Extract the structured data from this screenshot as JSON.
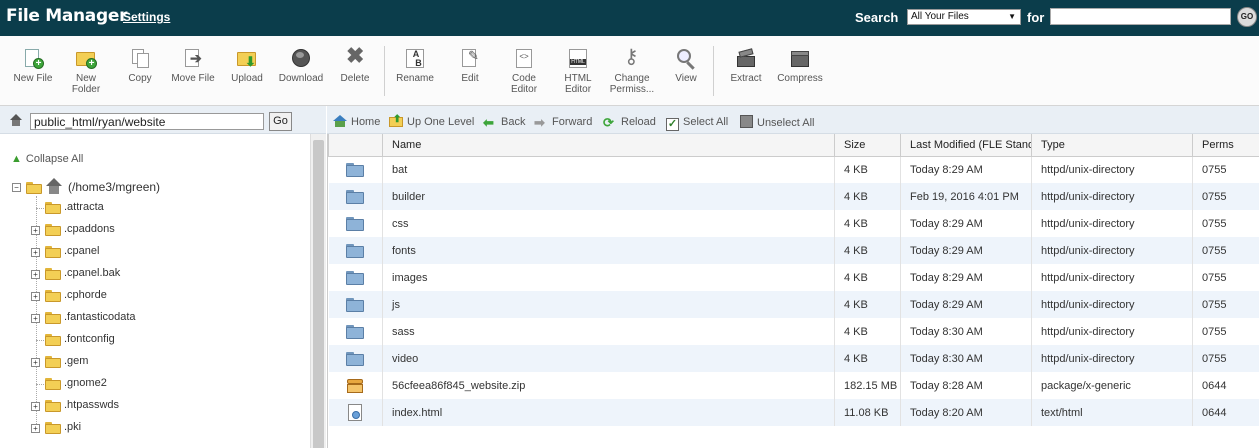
{
  "header": {
    "title": "File Manager",
    "settings_label": "Settings",
    "search_label": "Search",
    "search_scope": "All Your Files",
    "for_label": "for",
    "search_value": "",
    "go_label": "GO"
  },
  "toolbar": {
    "new_file": "New File",
    "new_folder_1": "New",
    "new_folder_2": "Folder",
    "copy": "Copy",
    "move_file": "Move File",
    "upload": "Upload",
    "download": "Download",
    "delete": "Delete",
    "rename": "Rename",
    "edit": "Edit",
    "code_editor_1": "Code",
    "code_editor_2": "Editor",
    "html_editor_1": "HTML",
    "html_editor_2": "Editor",
    "change_perms_1": "Change",
    "change_perms_2": "Permiss...",
    "view": "View",
    "extract": "Extract",
    "compress": "Compress"
  },
  "left": {
    "path_value": "public_html/ryan/website",
    "go_label": "Go",
    "collapse_all": "Collapse All",
    "root_label": "(/home3/mgreen)",
    "tree_items": [
      ".attracta",
      ".cpaddons",
      ".cpanel",
      ".cpanel.bak",
      ".cphorde",
      ".fantasticodata",
      ".fontconfig",
      ".gem",
      ".gnome2",
      ".htpasswds",
      ".pki"
    ]
  },
  "nav": {
    "home": "Home",
    "up_one_level": "Up One Level",
    "back": "Back",
    "forward": "Forward",
    "reload": "Reload",
    "select_all": "Select All",
    "unselect_all": "Unselect All"
  },
  "table": {
    "columns": [
      "Name",
      "Size",
      "Last Modified (FLE Standard Time)",
      "Type",
      "Perms"
    ],
    "rows": [
      {
        "icon": "folder",
        "name": "bat",
        "size": "4 KB",
        "modified": "Today 8:29 AM",
        "type": "httpd/unix-directory",
        "perms": "0755"
      },
      {
        "icon": "folder",
        "name": "builder",
        "size": "4 KB",
        "modified": "Feb 19, 2016 4:01 PM",
        "type": "httpd/unix-directory",
        "perms": "0755"
      },
      {
        "icon": "folder",
        "name": "css",
        "size": "4 KB",
        "modified": "Today 8:29 AM",
        "type": "httpd/unix-directory",
        "perms": "0755"
      },
      {
        "icon": "folder",
        "name": "fonts",
        "size": "4 KB",
        "modified": "Today 8:29 AM",
        "type": "httpd/unix-directory",
        "perms": "0755"
      },
      {
        "icon": "folder",
        "name": "images",
        "size": "4 KB",
        "modified": "Today 8:29 AM",
        "type": "httpd/unix-directory",
        "perms": "0755"
      },
      {
        "icon": "folder",
        "name": "js",
        "size": "4 KB",
        "modified": "Today 8:29 AM",
        "type": "httpd/unix-directory",
        "perms": "0755"
      },
      {
        "icon": "folder",
        "name": "sass",
        "size": "4 KB",
        "modified": "Today 8:30 AM",
        "type": "httpd/unix-directory",
        "perms": "0755"
      },
      {
        "icon": "folder",
        "name": "video",
        "size": "4 KB",
        "modified": "Today 8:30 AM",
        "type": "httpd/unix-directory",
        "perms": "0755"
      },
      {
        "icon": "zip",
        "name": "56cfeea86f845_website.zip",
        "size": "182.15 MB",
        "modified": "Today 8:28 AM",
        "type": "package/x-generic",
        "perms": "0644"
      },
      {
        "icon": "html",
        "name": "index.html",
        "size": "11.08 KB",
        "modified": "Today 8:20 AM",
        "type": "text/html",
        "perms": "0644"
      }
    ]
  },
  "colors": {
    "header_bg": "#0b3d4b",
    "panel_bar_bg": "#e9eff5",
    "row_alt_bg": "#eef4fb",
    "folder_blue": "#8eb3d8",
    "folder_yellow": "#f3cf55"
  }
}
